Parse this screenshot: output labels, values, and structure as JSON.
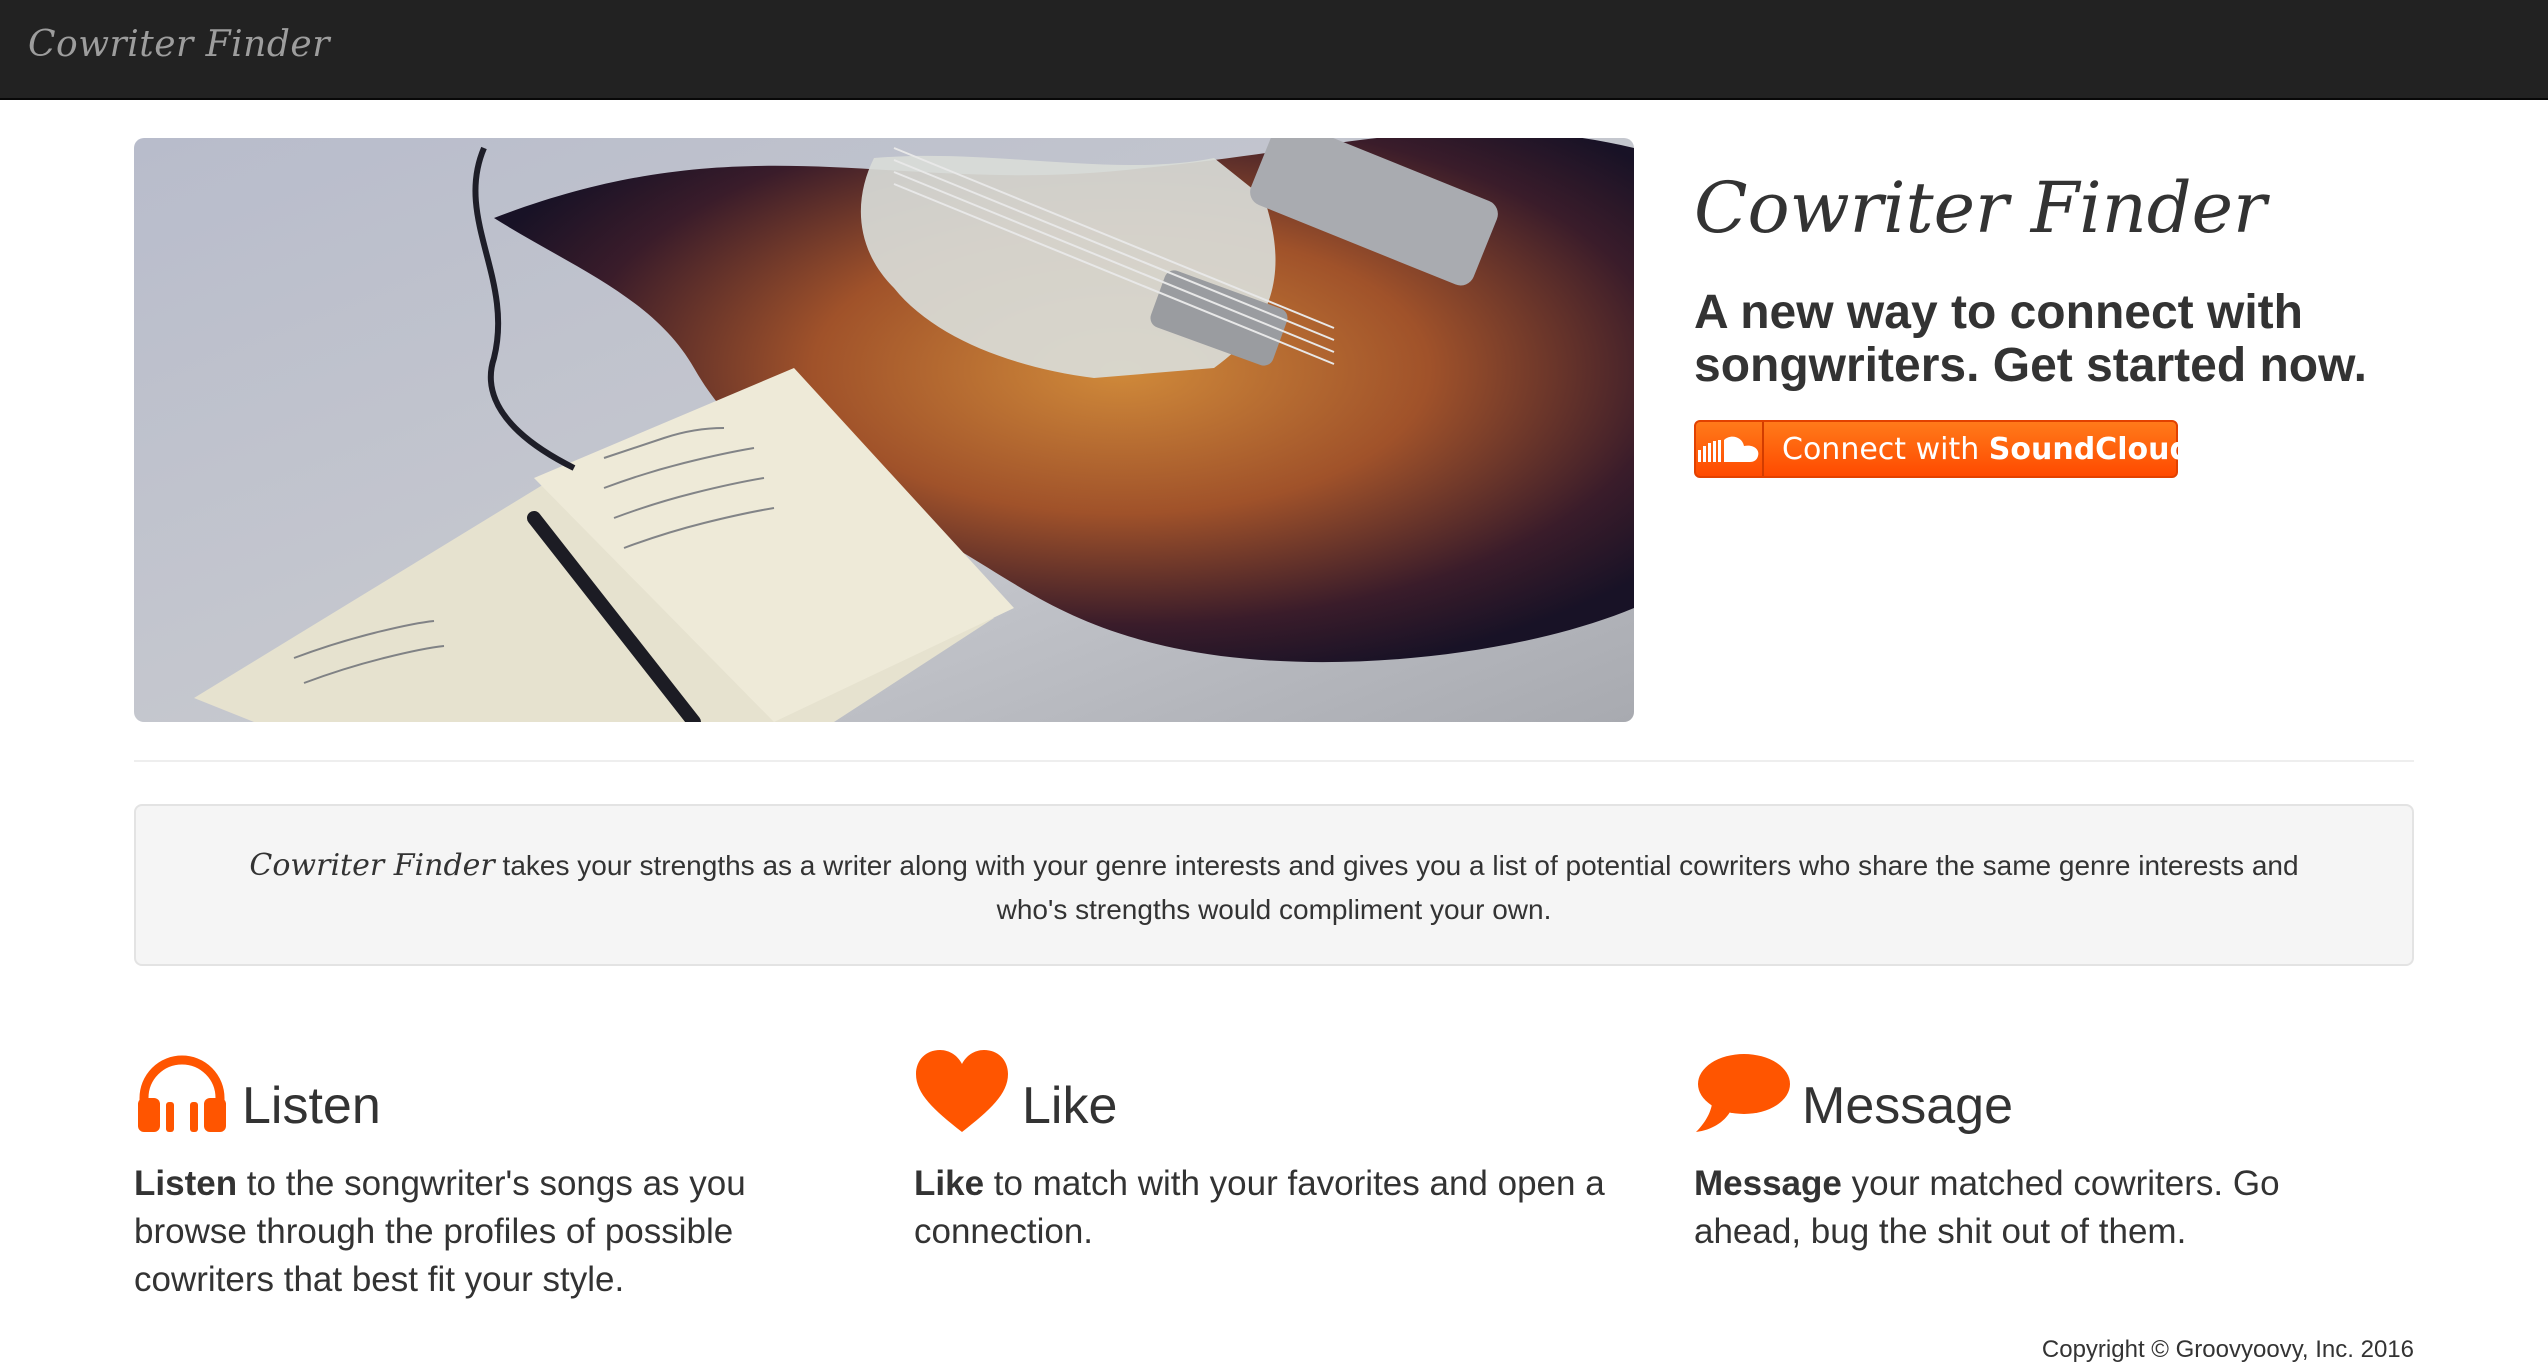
{
  "navbar": {
    "brand": "Cowriter Finder"
  },
  "hero": {
    "title": "Cowriter Finder",
    "subtitle": "A new way to connect with songwriters. Get started now."
  },
  "soundcloud_button": {
    "prefix": "Connect with ",
    "brand": "SoundCloud",
    "icon": "soundcloud-icon"
  },
  "description": {
    "brand": "Cowriter Finder",
    "text": " takes your strengths as a writer along with your genre interests and gives you a list of potential cowriters who share the same genre interests and who's strengths would compliment your own."
  },
  "features": [
    {
      "icon": "headphones-icon",
      "title": "Listen",
      "bold": "Listen",
      "text": " to the songwriter's songs as you browse through the profiles of possible cowriters that best fit your style."
    },
    {
      "icon": "heart-icon",
      "title": "Like",
      "bold": "Like",
      "text": " to match with your favorites and open a connection."
    },
    {
      "icon": "speech-bubble-icon",
      "title": "Message",
      "bold": "Message",
      "text": " your matched cowriters. Go ahead, bug the shit out of them."
    }
  ],
  "footer": {
    "copyright": "Copyright © Groovyoovy, Inc. 2016"
  },
  "colors": {
    "accent": "#ff5500",
    "navbar": "#222222"
  }
}
